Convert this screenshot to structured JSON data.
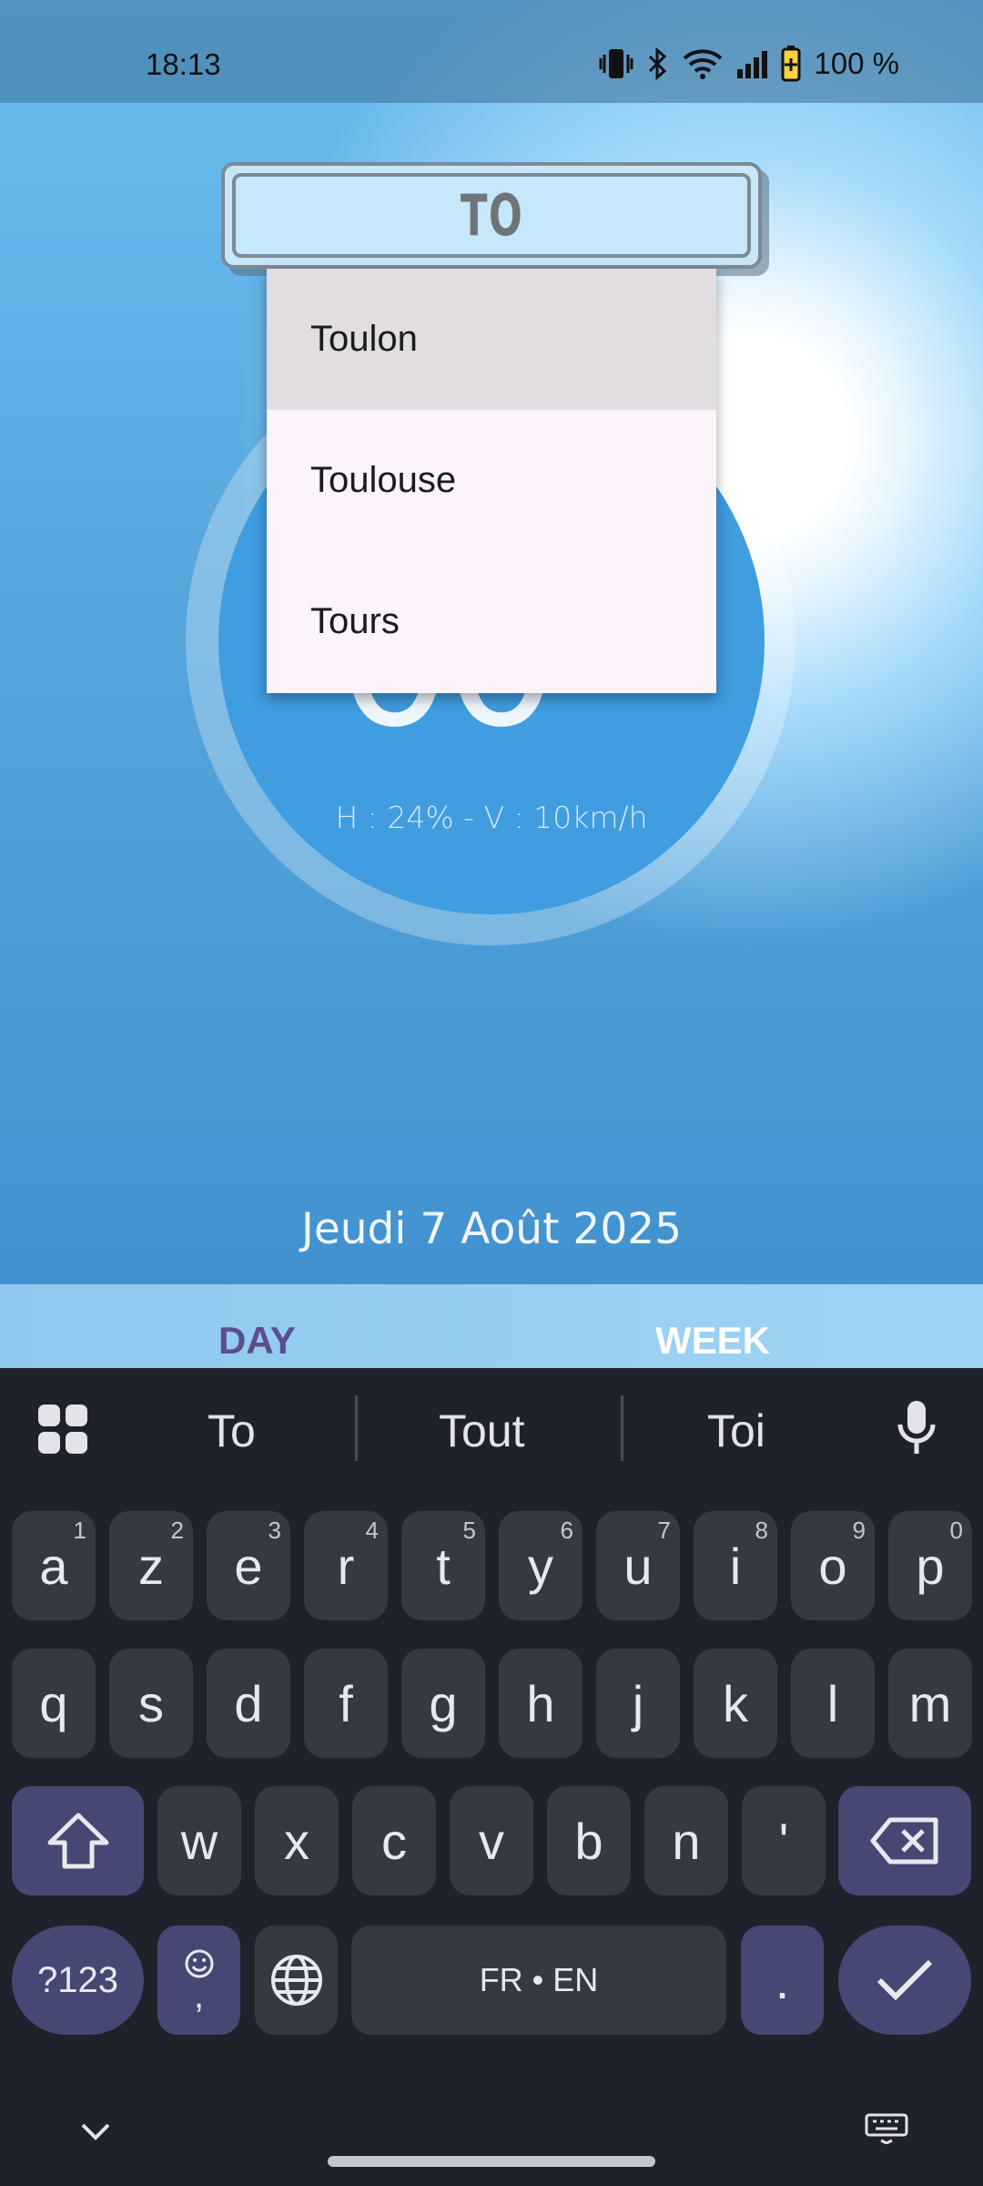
{
  "status_bar": {
    "time": "18:13",
    "battery": "100 %",
    "icons": [
      "vibrate-icon",
      "bluetooth-icon",
      "wifi-icon",
      "signal-icon",
      "battery-icon"
    ]
  },
  "search": {
    "value": "TO"
  },
  "suggestions": {
    "items": [
      "Toulon",
      "Toulouse",
      "Tours"
    ],
    "highlighted_index": 0
  },
  "weather": {
    "details": "H : 24% - V : 10km/h",
    "date": "Jeudi 7 Août 2025"
  },
  "tabs": {
    "day": "DAY",
    "week": "WEEK",
    "active": "DAY"
  },
  "keyboard": {
    "suggestions": [
      "To",
      "Tout",
      "Toi"
    ],
    "row1": [
      {
        "k": "a",
        "n": "1"
      },
      {
        "k": "z",
        "n": "2"
      },
      {
        "k": "e",
        "n": "3"
      },
      {
        "k": "r",
        "n": "4"
      },
      {
        "k": "t",
        "n": "5"
      },
      {
        "k": "y",
        "n": "6"
      },
      {
        "k": "u",
        "n": "7"
      },
      {
        "k": "i",
        "n": "8"
      },
      {
        "k": "o",
        "n": "9"
      },
      {
        "k": "p",
        "n": "0"
      }
    ],
    "row2": [
      "q",
      "s",
      "d",
      "f",
      "g",
      "h",
      "j",
      "k",
      "l",
      "m"
    ],
    "row3": [
      "w",
      "x",
      "c",
      "v",
      "b",
      "n",
      "'"
    ],
    "symbols_label": "?123",
    "emoji_comma": ",",
    "space_label": "FR • EN",
    "period": "."
  },
  "colors": {
    "sky_top": "#6cbef0",
    "sky_bottom": "#3e8fcd",
    "disc": "#3f9de0",
    "day_tab": "#5d4d8e",
    "keyboard_bg": "#1f222b",
    "key_bg": "#353944",
    "modifier_key_bg": "#454873"
  }
}
